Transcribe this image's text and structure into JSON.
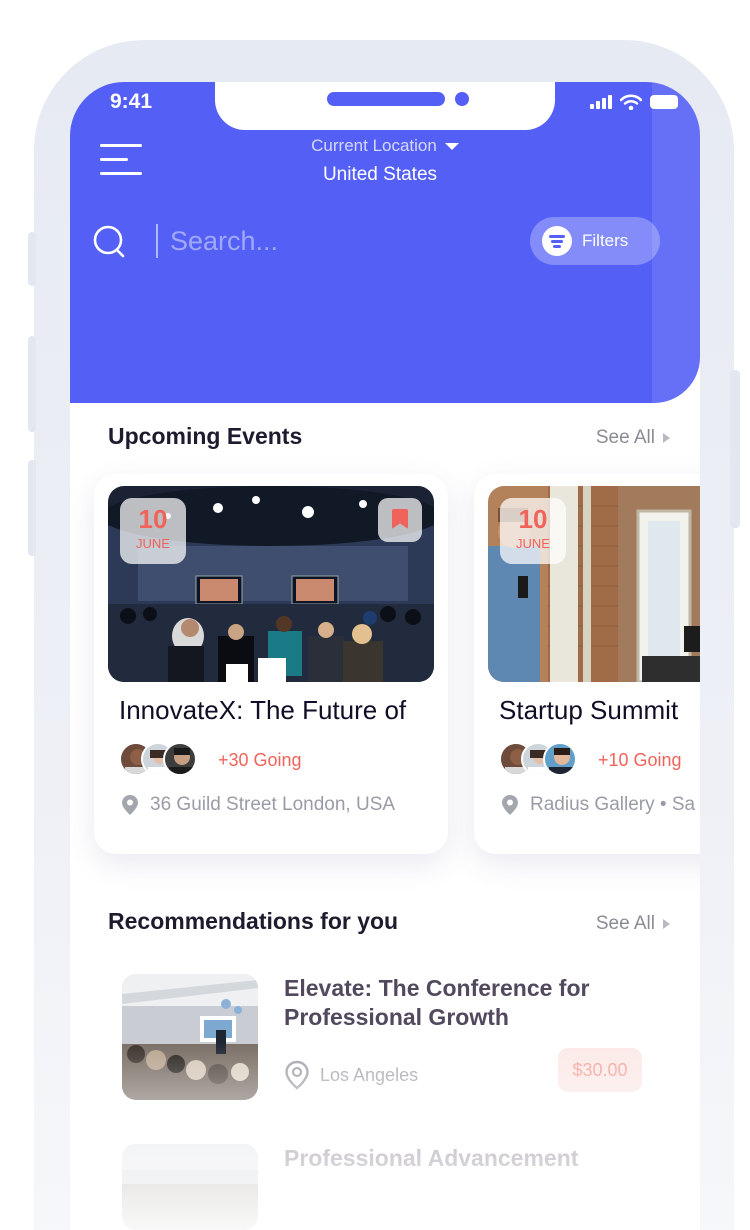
{
  "status_bar": {
    "time": "9:41"
  },
  "header": {
    "location_label": "Current Location",
    "location_value": "United States",
    "search_placeholder": "Search...",
    "filters_label": "Filters"
  },
  "upcoming": {
    "title": "Upcoming Events",
    "see_all": "See All",
    "events": [
      {
        "day": "10",
        "month": "JUNE",
        "title": "InnovateX: The Future of",
        "going": "+30 Going",
        "address": "36 Guild Street London, USA"
      },
      {
        "day": "10",
        "month": "JUNE",
        "title": "Startup Summit",
        "going": "+10 Going",
        "address": "Radius Gallery • Sa"
      }
    ]
  },
  "recommendations": {
    "title": "Recommendations for you",
    "see_all": "See All",
    "items": [
      {
        "title": "Elevate: The Conference for Professional Growth",
        "location": "Los Angeles",
        "price": "$30.00"
      },
      {
        "title": "Professional Advancement"
      }
    ]
  },
  "colors": {
    "brand": "#5460f5",
    "accent": "#f0635a",
    "text_dark": "#120d26",
    "muted": "#9a9ba6"
  }
}
